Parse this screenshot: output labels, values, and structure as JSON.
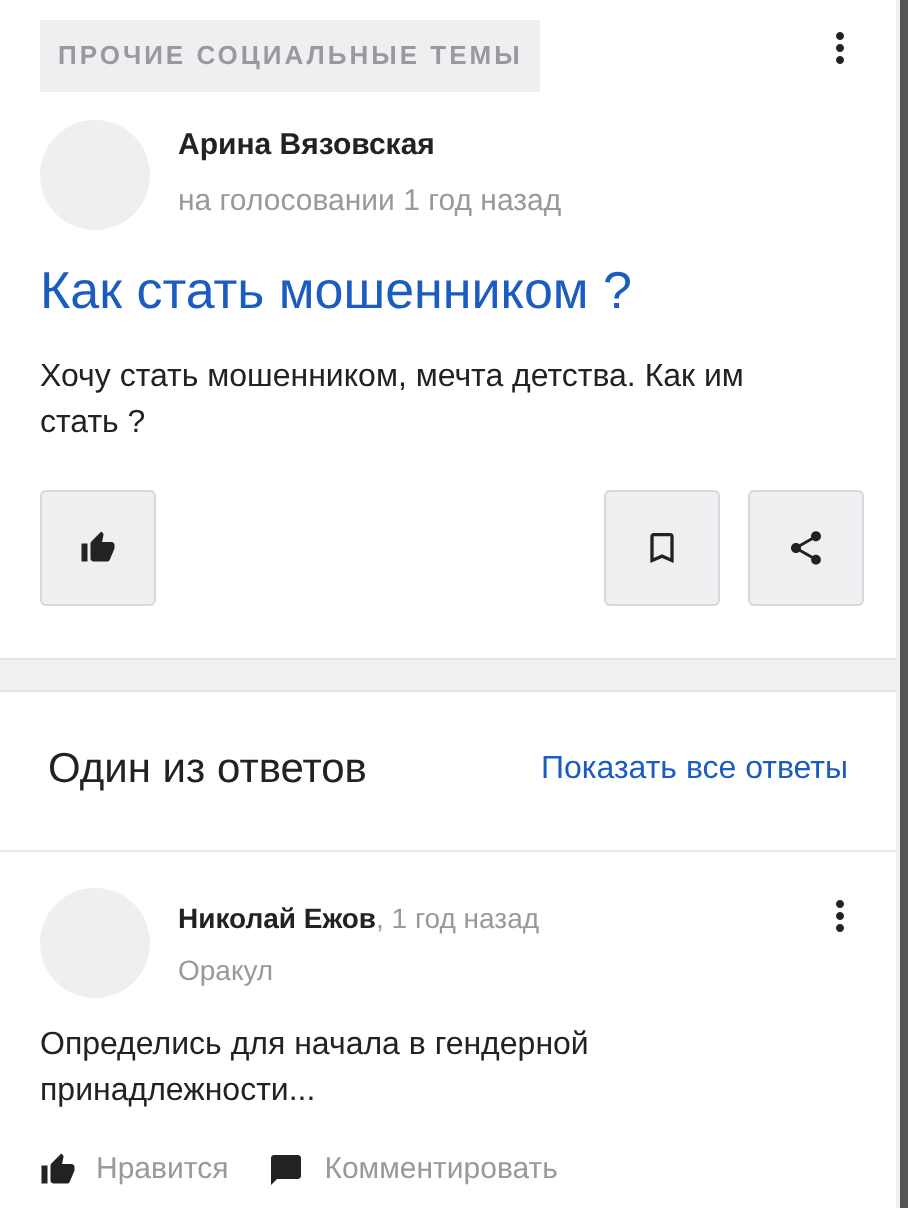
{
  "question": {
    "category": "ПРОЧИЕ СОЦИАЛЬНЫЕ ТЕМЫ",
    "author": "Арина Вязовская",
    "meta": "на голосовании 1 год назад",
    "title": "Как стать мошенником ?",
    "body": "Хочу стать мошенником, мечта детства. Как им стать ?"
  },
  "answers_header": {
    "title": "Один из ответов",
    "link": "Показать все ответы"
  },
  "answer": {
    "author": "Николай Ежов",
    "time": ", 1 год назад",
    "rank": "Оракул",
    "body": "Определись для начала в гендерной принадлежности...",
    "actions": [
      {
        "kind": "like",
        "label": "Нравится"
      },
      {
        "kind": "comment",
        "label": "Комментировать"
      }
    ]
  }
}
